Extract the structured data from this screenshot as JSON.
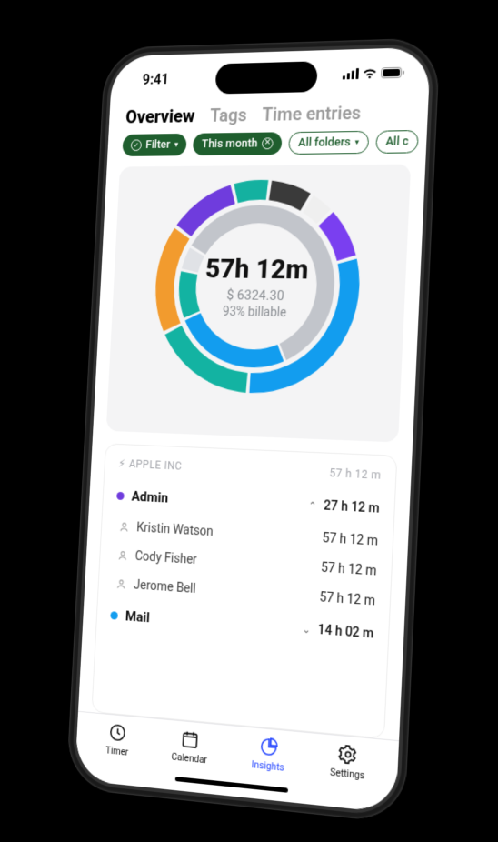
{
  "status": {
    "time": "9:41"
  },
  "tabs": {
    "overview": "Overview",
    "tags": "Tags",
    "time_entries": "Time entries"
  },
  "chips": {
    "filter": "Filter",
    "period": "This month",
    "folders": "All folders",
    "extra": "All c"
  },
  "summary": {
    "time": "57h 12m",
    "amount": "$ 6324.30",
    "billable": "93% billable"
  },
  "chart_data": {
    "type": "donut",
    "title": "Time distribution",
    "rings": [
      {
        "name": "outer",
        "segments": [
          {
            "color": "#6f3cdd",
            "value": 11
          },
          {
            "color": "#14b1a0",
            "value": 6
          },
          {
            "color": "#3a3a3a",
            "value": 7
          },
          {
            "color": "#efefef",
            "value": 4
          },
          {
            "color": "#7a3ff0",
            "value": 8
          },
          {
            "color": "#129def",
            "value": 30
          },
          {
            "color": "#13b3a2",
            "value": 17
          },
          {
            "color": "#f29b2e",
            "value": 17
          }
        ]
      },
      {
        "name": "inner",
        "segments": [
          {
            "color": "#c2c5cb",
            "value": 60
          },
          {
            "color": "#129def",
            "value": 25
          },
          {
            "color": "#13b3a2",
            "value": 10
          },
          {
            "color": "#e0e2e6",
            "value": 5
          }
        ]
      }
    ],
    "center": {
      "time": "57h 12m",
      "amount": "$ 6324.30",
      "billable_pct": 93
    }
  },
  "company": {
    "name": "APPLE INC",
    "time": "57 h  12 m"
  },
  "groups": [
    {
      "color": "#6f3cdd",
      "name": "Admin",
      "time": "27 h 12 m",
      "expanded": true,
      "people": [
        {
          "name": "Kristin Watson",
          "time": "57 h 12 m"
        },
        {
          "name": "Cody Fisher",
          "time": "57 h 12 m"
        },
        {
          "name": "Jerome Bell",
          "time": "57 h 12 m"
        }
      ]
    },
    {
      "color": "#129def",
      "name": "Mail",
      "time": "14 h  02 m",
      "expanded": false,
      "people": []
    }
  ],
  "nav": {
    "timer": "Timer",
    "calendar": "Calendar",
    "insights": "Insights",
    "settings": "Settings"
  }
}
